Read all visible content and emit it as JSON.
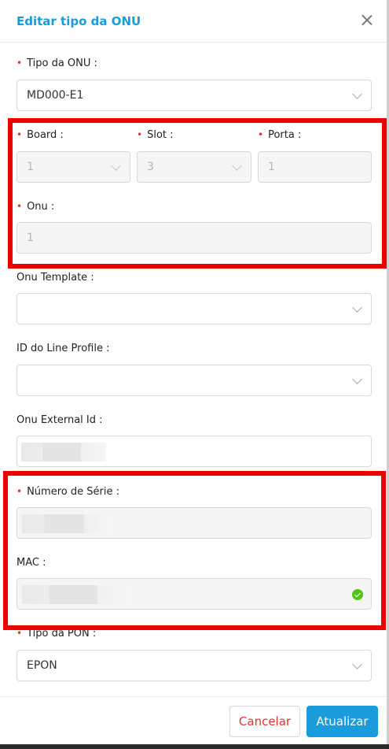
{
  "modal": {
    "title": "Editar tipo da ONU"
  },
  "fields": {
    "tipo_onu": {
      "label": "Tipo da ONU :",
      "value": "MD000-E1",
      "required": true
    },
    "board": {
      "label": "Board :",
      "value": "1",
      "required": true
    },
    "slot": {
      "label": "Slot :",
      "value": "3",
      "required": true
    },
    "porta": {
      "label": "Porta :",
      "value": "1",
      "required": true
    },
    "onu": {
      "label": "Onu :",
      "value": "1",
      "required": true
    },
    "onu_template": {
      "label": "Onu Template :",
      "value": ""
    },
    "line_profile": {
      "label": "ID do Line Profile :",
      "value": ""
    },
    "external_id": {
      "label": "Onu External Id :"
    },
    "numero_serie": {
      "label": "Número de Série :",
      "required": true
    },
    "mac": {
      "label": "MAC :"
    },
    "tipo_pon": {
      "label": "Tipo da PON :",
      "value": "EPON",
      "required": true
    }
  },
  "required_marker": "•",
  "footer": {
    "cancel_label": "Cancelar",
    "update_label": "Atualizar"
  },
  "colors": {
    "accent": "#1a9bdc",
    "required": "#e8302c",
    "highlight": "#ee0000",
    "success": "#52c41a"
  }
}
